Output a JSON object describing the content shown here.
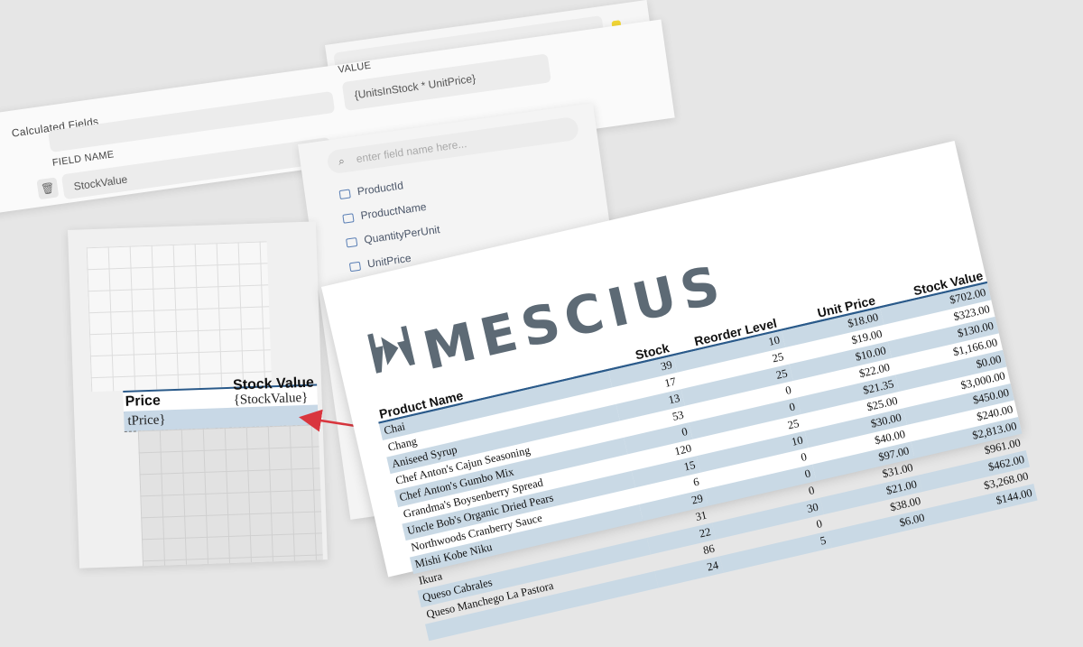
{
  "calculated_fields": {
    "title": "Calculated Fields",
    "field_name_label": "FIELD NAME",
    "value_label": "VALUE",
    "field_name": "StockValue",
    "value": "{UnitsInStock * UnitPrice}"
  },
  "field_list": {
    "search_placeholder": "enter field name here...",
    "fields": [
      "ProductId",
      "ProductName",
      "QuantityPerUnit",
      "UnitPrice"
    ]
  },
  "designer": {
    "header_price": "Price",
    "header_stock_value": "Stock Value",
    "detail_price_expr": "tPrice}",
    "detail_stock_expr": "{StockValue}"
  },
  "report": {
    "logo_text": "MESCIUS",
    "columns": [
      "Product Name",
      "Stock",
      "Reorder Level",
      "Unit Price",
      "Stock Value"
    ],
    "rows": [
      {
        "name": "Chai",
        "stock": "39",
        "reorder": "10",
        "price": "$18.00",
        "value": "$702.00"
      },
      {
        "name": "Chang",
        "stock": "17",
        "reorder": "25",
        "price": "$19.00",
        "value": "$323.00"
      },
      {
        "name": "Aniseed Syrup",
        "stock": "13",
        "reorder": "25",
        "price": "$10.00",
        "value": "$130.00"
      },
      {
        "name": "Chef Anton's Cajun Seasoning",
        "stock": "53",
        "reorder": "0",
        "price": "$22.00",
        "value": "$1,166.00"
      },
      {
        "name": "Chef Anton's Gumbo Mix",
        "stock": "0",
        "reorder": "0",
        "price": "$21.35",
        "value": "$0.00"
      },
      {
        "name": "Grandma's Boysenberry Spread",
        "stock": "120",
        "reorder": "25",
        "price": "$25.00",
        "value": "$3,000.00"
      },
      {
        "name": "Uncle Bob's Organic Dried Pears",
        "stock": "15",
        "reorder": "10",
        "price": "$30.00",
        "value": "$450.00"
      },
      {
        "name": "Northwoods Cranberry Sauce",
        "stock": "6",
        "reorder": "0",
        "price": "$40.00",
        "value": "$240.00"
      },
      {
        "name": "Mishi Kobe Niku",
        "stock": "29",
        "reorder": "0",
        "price": "$97.00",
        "value": "$2,813.00"
      },
      {
        "name": "Ikura",
        "stock": "31",
        "reorder": "0",
        "price": "$31.00",
        "value": "$961.00"
      },
      {
        "name": "Queso Cabrales",
        "stock": "22",
        "reorder": "30",
        "price": "$21.00",
        "value": "$462.00"
      },
      {
        "name": "Queso Manchego La Pastora",
        "stock": "86",
        "reorder": "0",
        "price": "$38.00",
        "value": "$3,268.00"
      },
      {
        "name": "",
        "stock": "24",
        "reorder": "5",
        "price": "$6.00",
        "value": "$144.00"
      }
    ]
  },
  "colors": {
    "accent_blue": "#2a5a8a",
    "row_band": "#c9d9e5",
    "logo_gray": "#5d6a75",
    "arrow_red": "#d9363e",
    "icon_yellow": "#f2d635"
  }
}
